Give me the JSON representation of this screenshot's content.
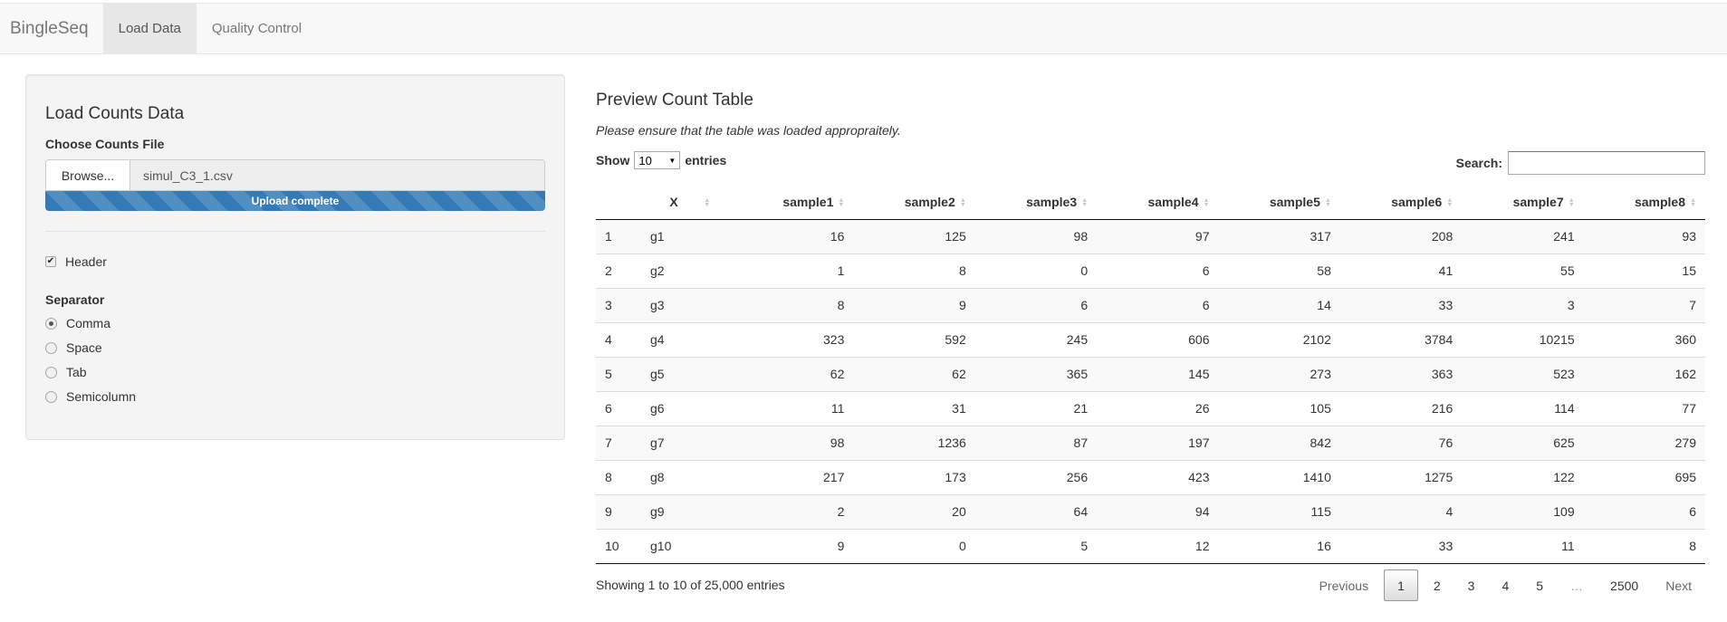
{
  "navbar": {
    "brand": "BingleSeq",
    "tabs": [
      {
        "label": "Load Data",
        "active": true
      },
      {
        "label": "Quality Control",
        "active": false
      }
    ]
  },
  "sidebar": {
    "title": "Load Counts Data",
    "file_label": "Choose Counts File",
    "browse_label": "Browse...",
    "file_name": "simul_C3_1.csv",
    "upload_status": "Upload complete",
    "upload_progress_percent": 100,
    "header_checkbox": {
      "label": "Header",
      "checked": true
    },
    "separator_label": "Separator",
    "separator_options": [
      {
        "label": "Comma",
        "selected": true
      },
      {
        "label": "Space",
        "selected": false
      },
      {
        "label": "Tab",
        "selected": false
      },
      {
        "label": "Semicolumn",
        "selected": false
      }
    ]
  },
  "main": {
    "title": "Preview Count Table",
    "note": "Please ensure that the table was loaded appropraitely.",
    "length": {
      "show_label": "Show",
      "value": "10",
      "entries_label": "entries"
    },
    "search": {
      "label": "Search:",
      "value": ""
    },
    "table": {
      "columns": [
        "",
        "X",
        "sample1",
        "sample2",
        "sample3",
        "sample4",
        "sample5",
        "sample6",
        "sample7",
        "sample8"
      ],
      "rows": [
        [
          "1",
          "g1",
          "16",
          "125",
          "98",
          "97",
          "317",
          "208",
          "241",
          "93"
        ],
        [
          "2",
          "g2",
          "1",
          "8",
          "0",
          "6",
          "58",
          "41",
          "55",
          "15"
        ],
        [
          "3",
          "g3",
          "8",
          "9",
          "6",
          "6",
          "14",
          "33",
          "3",
          "7"
        ],
        [
          "4",
          "g4",
          "323",
          "592",
          "245",
          "606",
          "2102",
          "3784",
          "10215",
          "360"
        ],
        [
          "5",
          "g5",
          "62",
          "62",
          "365",
          "145",
          "273",
          "363",
          "523",
          "162"
        ],
        [
          "6",
          "g6",
          "11",
          "31",
          "21",
          "26",
          "105",
          "216",
          "114",
          "77"
        ],
        [
          "7",
          "g7",
          "98",
          "1236",
          "87",
          "197",
          "842",
          "76",
          "625",
          "279"
        ],
        [
          "8",
          "g8",
          "217",
          "173",
          "256",
          "423",
          "1410",
          "1275",
          "122",
          "695"
        ],
        [
          "9",
          "g9",
          "2",
          "20",
          "64",
          "94",
          "115",
          "4",
          "109",
          "6"
        ],
        [
          "10",
          "g10",
          "9",
          "0",
          "5",
          "12",
          "16",
          "33",
          "11",
          "8"
        ]
      ]
    },
    "info": "Showing 1 to 10 of 25,000 entries",
    "pagination": {
      "previous": "Previous",
      "pages": [
        "1",
        "2",
        "3",
        "4",
        "5",
        "…",
        "2500"
      ],
      "current": "1",
      "next": "Next"
    }
  }
}
